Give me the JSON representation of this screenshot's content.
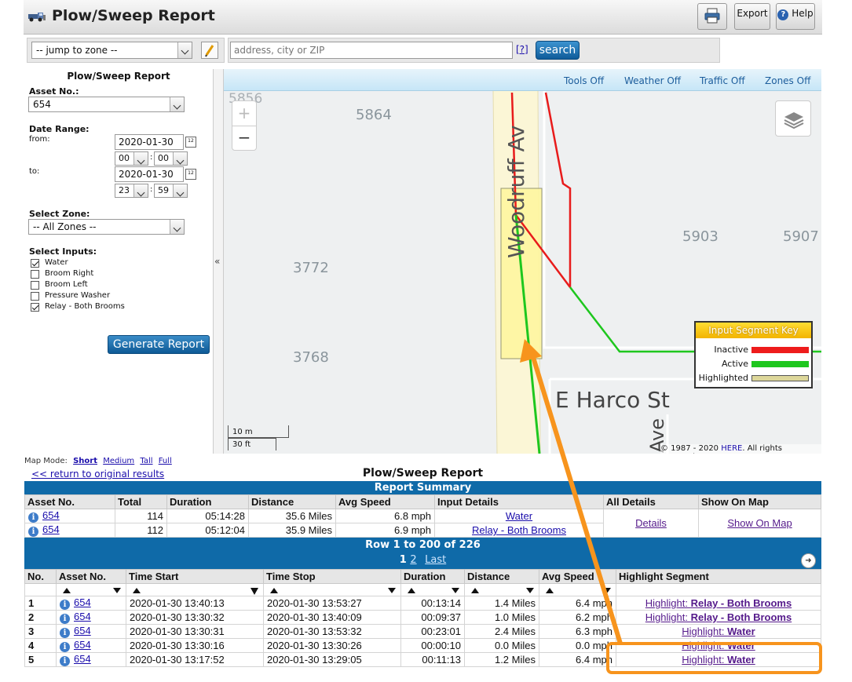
{
  "app": {
    "title": "Plow/Sweep Report"
  },
  "toolbar": {
    "export_label": "Export",
    "help_label": "Help"
  },
  "search": {
    "zone_select": "-- jump to zone --",
    "address_placeholder": "address, city or ZIP",
    "help_link": "[?]",
    "search_label": "search"
  },
  "panel": {
    "title": "Plow/Sweep Report",
    "asset_label": "Asset No.:",
    "asset_value": "654",
    "date_range_label": "Date Range:",
    "from_label": "from:",
    "to_label": "to:",
    "from_date": "2020-01-30",
    "from_hour": "00",
    "from_min": "00",
    "to_date": "2020-01-30",
    "to_hour": "23",
    "to_min": "59",
    "zone_label": "Select Zone:",
    "zone_value": "-- All Zones --",
    "inputs_label": "Select Inputs:",
    "inputs": [
      {
        "label": "Water",
        "checked": true
      },
      {
        "label": "Broom Right",
        "checked": false
      },
      {
        "label": "Broom Left",
        "checked": false
      },
      {
        "label": "Pressure Washer",
        "checked": false
      },
      {
        "label": "Relay - Both Brooms",
        "checked": true
      }
    ],
    "generate_label": "Generate Report",
    "collapse_glyph": "«"
  },
  "map": {
    "tools": [
      "Tools Off",
      "Weather Off",
      "Traffic Off",
      "Zones Off"
    ],
    "labels": {
      "n5856": "5856",
      "n5864": "5864",
      "n5903": "5903",
      "n5907": "5907",
      "n3772": "3772",
      "n3768": "3768",
      "woodruff": "Woodruff Av",
      "harco": "E Harco St",
      "ave": "Ave"
    },
    "zoom_in": "+",
    "zoom_out": "−",
    "scale_m": "10 m",
    "scale_ft": "30 ft",
    "copyright_pre": "© 1987 - 2020 ",
    "copyright_link": "HERE",
    "copyright_post": ". All rights reserved.",
    "key": {
      "title": "Input Segment Key",
      "items": [
        {
          "label": "Inactive",
          "color": "#ee1c1c"
        },
        {
          "label": "Active",
          "color": "#1ec71e"
        },
        {
          "label": "Highlighted",
          "color": "#ddd79a"
        }
      ]
    }
  },
  "mapmode": {
    "label": "Map Mode:",
    "modes": [
      "Short",
      "Medium",
      "Tall",
      "Full"
    ]
  },
  "report": {
    "return_link": "<< return to original results",
    "title": "Plow/Sweep Report",
    "summary_title": "Report Summary",
    "summary_headers": [
      "Asset No.",
      "Total",
      "Duration",
      "Distance",
      "Avg Speed",
      "Input Details",
      "All Details",
      "Show On Map"
    ],
    "summary_rows": [
      {
        "asset": "654",
        "total": "114",
        "duration": "05:14:28",
        "distance": "35.6 Miles",
        "speed": "6.8 mph",
        "input": "Water"
      },
      {
        "asset": "654",
        "total": "112",
        "duration": "05:12:04",
        "distance": "35.9 Miles",
        "speed": "6.9 mph",
        "input": "Relay - Both Brooms"
      }
    ],
    "details_link": "Details",
    "show_map_link": "Show On Map",
    "rows_label": "Row 1 to 200 of 226",
    "pager": {
      "current": "1",
      "next": "2",
      "last": "Last"
    },
    "detail_headers": [
      "No.",
      "Asset No.",
      "Time Start",
      "Time Stop",
      "Duration",
      "Distance",
      "Avg Speed",
      "Highlight Segment"
    ],
    "highlight_prefix": "Highlight: ",
    "detail_rows": [
      {
        "no": "1",
        "asset": "654",
        "start": "2020-01-30 13:40:13",
        "stop": "2020-01-30 13:53:27",
        "duration": "00:13:14",
        "distance": "1.4 Miles",
        "speed": "6.4 mph",
        "input": "Relay - Both Brooms"
      },
      {
        "no": "2",
        "asset": "654",
        "start": "2020-01-30 13:30:32",
        "stop": "2020-01-30 13:40:09",
        "duration": "00:09:37",
        "distance": "1.0 Miles",
        "speed": "6.2 mph",
        "input": "Relay - Both Brooms"
      },
      {
        "no": "3",
        "asset": "654",
        "start": "2020-01-30 13:30:31",
        "stop": "2020-01-30 13:53:32",
        "duration": "00:23:01",
        "distance": "2.4 Miles",
        "speed": "6.3 mph",
        "input": "Water"
      },
      {
        "no": "4",
        "asset": "654",
        "start": "2020-01-30 13:30:16",
        "stop": "2020-01-30 13:30:26",
        "duration": "00:00:10",
        "distance": "0.0 Miles",
        "speed": "0.0 mph",
        "input": "Water"
      },
      {
        "no": "5",
        "asset": "654",
        "start": "2020-01-30 13:17:52",
        "stop": "2020-01-30 13:29:05",
        "duration": "00:11:13",
        "distance": "1.2 Miles",
        "speed": "6.4 mph",
        "input": "Water"
      }
    ]
  },
  "colors": {
    "accent": "#0f6aa8",
    "callout": "#f7941d"
  }
}
